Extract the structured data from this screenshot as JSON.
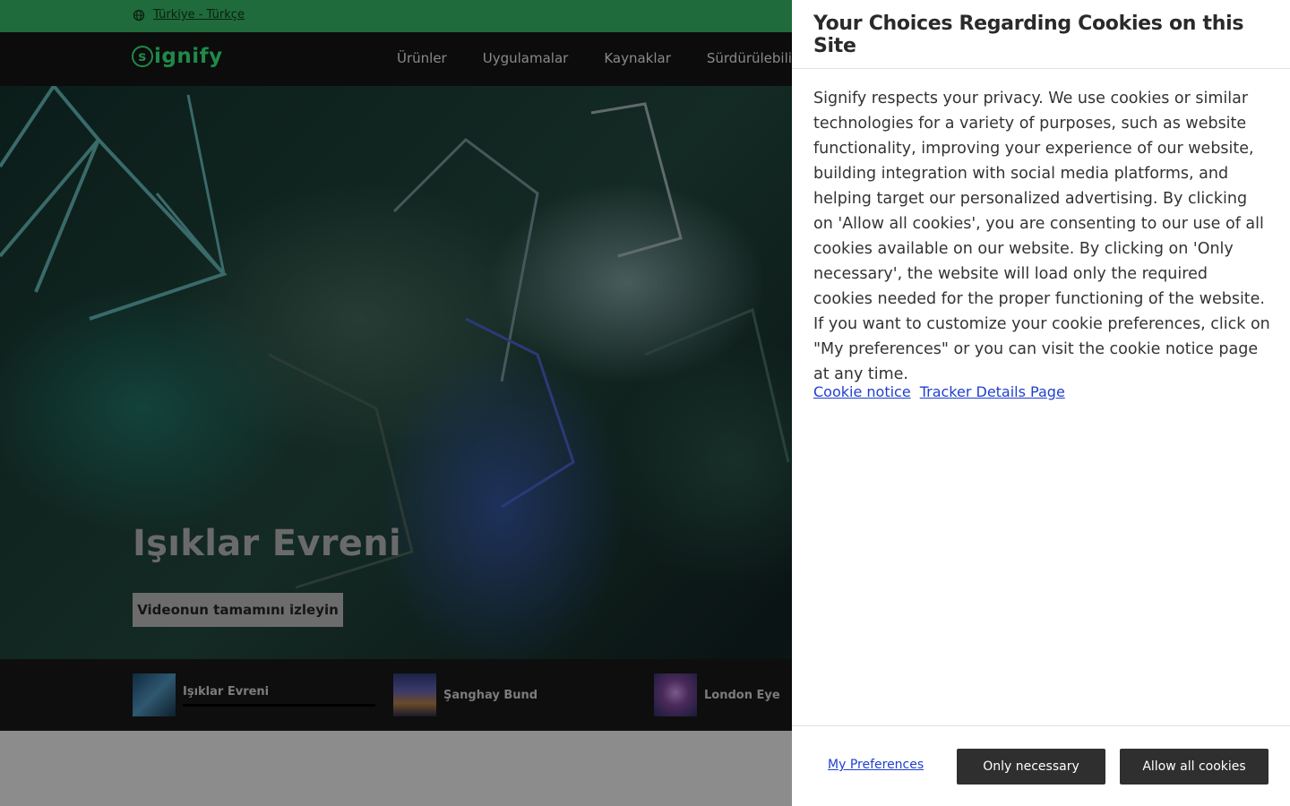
{
  "locale": {
    "label": "Türkiye - Türkçe",
    "icon": "globe-icon"
  },
  "header": {
    "logo": "signify",
    "nav": [
      "Ürünler",
      "Uygulamalar",
      "Kaynaklar",
      "Sürdürülebilirli"
    ]
  },
  "hero": {
    "title": "Işıklar Evreni",
    "cta": "Videonun tamamını izleyin"
  },
  "thumbnails": [
    {
      "label": "Işıklar Evreni"
    },
    {
      "label": "Şanghay Bund"
    },
    {
      "label": "London Eye"
    }
  ],
  "cookie": {
    "title": "Your Choices Regarding Cookies on this Site",
    "body": "Signify respects your privacy. We use cookies or similar technologies for a variety of purposes, such as website functionality, improving your experience of our website, building integration with social media platforms, and helping target our personalized advertising. By clicking on 'Allow all cookies', you are consenting to our use of all cookies available on our website. By clicking on 'Only necessary', the website will load only the required cookies needed for the proper functioning of the website. If you want to customize your cookie preferences, click on \"My preferences\" or you can visit the cookie notice page at any time.",
    "links": [
      "Cookie notice",
      "Tracker Details Page"
    ],
    "preferences_label": "My Preferences",
    "only_necessary_label": "Only necessary",
    "allow_all_label": "Allow all cookies"
  },
  "colors": {
    "brand_green": "#1f8a4a",
    "locale_bar": "#1f6b3b",
    "link_blue": "#1f3fcf",
    "button_dark": "#2f2f2f"
  }
}
